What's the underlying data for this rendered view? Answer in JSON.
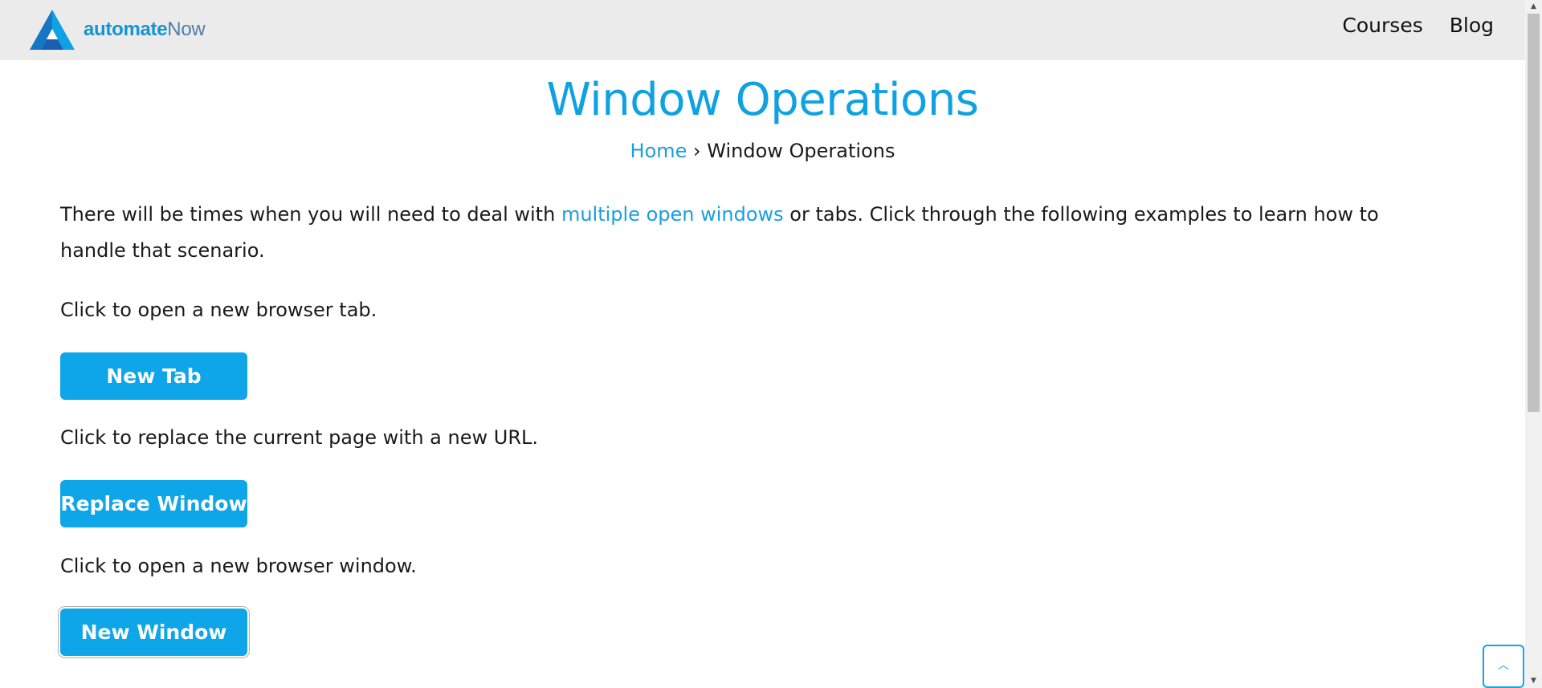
{
  "header": {
    "logo_bold": "automate",
    "logo_light": "Now",
    "nav": [
      {
        "label": "Courses"
      },
      {
        "label": "Blog"
      }
    ]
  },
  "main": {
    "title": "Window Operations",
    "breadcrumb": {
      "home": "Home",
      "separator": "›",
      "current": "Window Operations"
    },
    "intro": {
      "before": "There will be times when you will need to deal with ",
      "link": "multiple open windows",
      "after": " or tabs. Click through the following examples to learn how to handle that scenario."
    },
    "sections": [
      {
        "prompt": "Click to open a new browser tab.",
        "button": "New Tab"
      },
      {
        "prompt": "Click to replace the current page with a new URL.",
        "button": "Replace Window"
      },
      {
        "prompt": "Click to open a new browser window.",
        "button": "New Window"
      }
    ]
  },
  "colors": {
    "accent": "#0ea5e9",
    "title": "#0fa2e2",
    "header_bg": "#ebebeb"
  },
  "icons": {
    "back_to_top": "chevron-up-icon",
    "logo": "automatenow-logo-icon"
  }
}
